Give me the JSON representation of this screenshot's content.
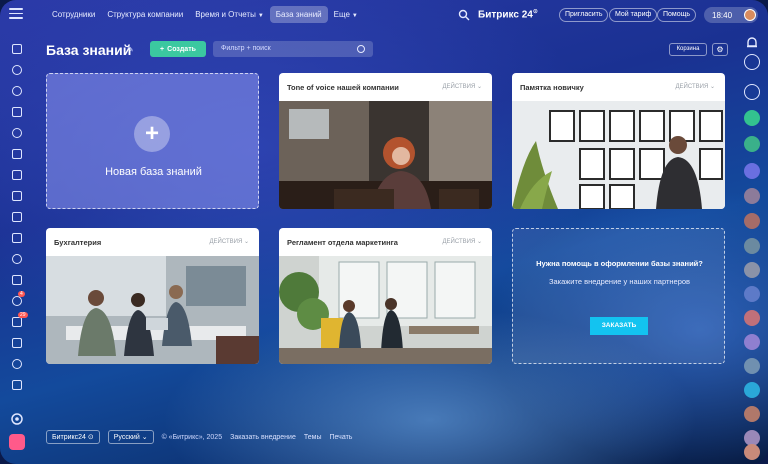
{
  "topbar": {
    "nav": [
      {
        "label": "Сотрудники",
        "active": false
      },
      {
        "label": "Структура компании",
        "active": false
      },
      {
        "label": "Время и Отчеты",
        "active": false,
        "has_dropdown": true
      },
      {
        "label": "База знаний",
        "active": true
      },
      {
        "label": "Еще",
        "active": false,
        "has_dropdown": true
      }
    ],
    "brand": "Битрикс 24",
    "invite": "Пригласить",
    "tariff": "Мой тариф",
    "help": "Помощь",
    "time": "18:40"
  },
  "sidebar": {
    "badges": {
      "item12": "4",
      "item13": "29"
    }
  },
  "header": {
    "title": "База знаний",
    "create_label": "Создать",
    "filter_placeholder": "Фильтр + поиск",
    "basket_label": "Корзина"
  },
  "cards": {
    "new_label": "Новая база знаний",
    "actions_label": "ДЕЙСТВИЯ",
    "items": [
      {
        "title": "Tone of voice нашей компании"
      },
      {
        "title": "Памятка новичку"
      },
      {
        "title": "Бухгалтерия"
      },
      {
        "title": "Регламент отдела маркетинга"
      }
    ],
    "help": {
      "heading": "Нужна помощь в оформлении базы знаний?",
      "text": "Закажите внедрение у наших партнеров",
      "button": "ЗАКАЗАТЬ"
    }
  },
  "footer": {
    "brand": "Битрикс24",
    "language": "Русский",
    "copyright": "© «Битрикс», 2025",
    "order": "Заказать внедрение",
    "themes": "Темы",
    "print": "Печать"
  },
  "colors": {
    "create": "#3bc8a0",
    "order_button": "#13c3f0",
    "badge": "#ff5752"
  },
  "icons": [
    "menu-icon",
    "search-icon",
    "pin-icon",
    "gear-icon",
    "bell-icon",
    "plus-icon",
    "chevron-down-icon"
  ]
}
